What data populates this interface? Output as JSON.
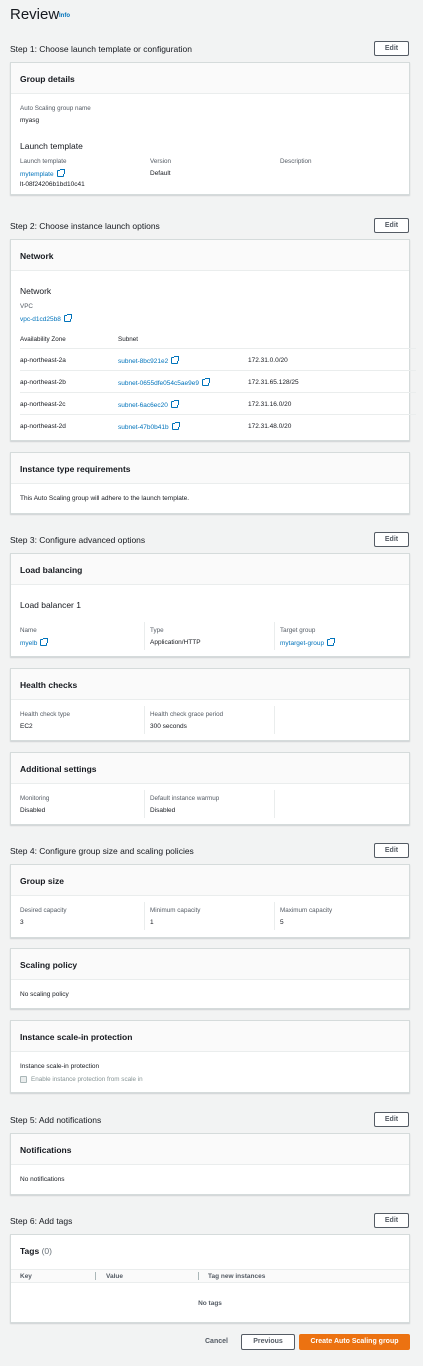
{
  "page": {
    "title": "Review",
    "info": "Info"
  },
  "edit_label": "Edit",
  "step1": {
    "label": "Step 1: Choose launch template or configuration",
    "group_details": {
      "title": "Group details",
      "asg_name_label": "Auto Scaling group name",
      "asg_name": "myasg",
      "lt_section": "Launch template",
      "lt_label": "Launch template",
      "lt_name": "mytemplate",
      "lt_id": "lt-08f24206b1bd10c41",
      "version_label": "Version",
      "version": "Default",
      "description_label": "Description"
    }
  },
  "step2": {
    "label": "Step 2: Choose instance launch options",
    "network": {
      "title": "Network",
      "subtitle": "Network",
      "vpc_label": "VPC",
      "vpc": "vpc-d1cd25b8",
      "az_header": "Availability Zone",
      "subnet_header": "Subnet",
      "rows": [
        {
          "az": "ap-northeast-2a",
          "subnet": "subnet-8bc921e2",
          "cidr": "172.31.0.0/20"
        },
        {
          "az": "ap-northeast-2b",
          "subnet": "subnet-0655dfe054c5ae9e9",
          "cidr": "172.31.65.128/25"
        },
        {
          "az": "ap-northeast-2c",
          "subnet": "subnet-6ac6ec20",
          "cidr": "172.31.16.0/20"
        },
        {
          "az": "ap-northeast-2d",
          "subnet": "subnet-47b0b41b",
          "cidr": "172.31.48.0/20"
        }
      ]
    },
    "instance_type": {
      "title": "Instance type requirements",
      "text": "This Auto Scaling group will adhere to the launch template."
    }
  },
  "step3": {
    "label": "Step 3: Configure advanced options",
    "load_balancing": {
      "title": "Load balancing",
      "subtitle": "Load balancer 1",
      "name_label": "Name",
      "name": "myelb",
      "type_label": "Type",
      "type": "Application/HTTP",
      "tg_label": "Target group",
      "tg": "mytarget-group"
    },
    "health_checks": {
      "title": "Health checks",
      "type_label": "Health check type",
      "type": "EC2",
      "grace_label": "Health check grace period",
      "grace": "300 seconds"
    },
    "additional": {
      "title": "Additional settings",
      "monitoring_label": "Monitoring",
      "monitoring": "Disabled",
      "warmup_label": "Default instance warmup",
      "warmup": "Disabled"
    }
  },
  "step4": {
    "label": "Step 4: Configure group size and scaling policies",
    "group_size": {
      "title": "Group size",
      "desired_label": "Desired capacity",
      "desired": "3",
      "min_label": "Minimum capacity",
      "min": "1",
      "max_label": "Maximum capacity",
      "max": "5"
    },
    "scaling_policy": {
      "title": "Scaling policy",
      "text": "No scaling policy"
    },
    "scale_in": {
      "title": "Instance scale-in protection",
      "label": "Instance scale-in protection",
      "checkbox_label": "Enable instance protection from scale in"
    }
  },
  "step5": {
    "label": "Step 5: Add notifications",
    "notifications": {
      "title": "Notifications",
      "text": "No notifications"
    }
  },
  "step6": {
    "label": "Step 6: Add tags",
    "tags": {
      "title": "Tags",
      "count": "(0)",
      "col_key": "Key",
      "col_value": "Value",
      "col_tag_new": "Tag new instances",
      "empty": "No tags"
    }
  },
  "footer": {
    "cancel": "Cancel",
    "previous": "Previous",
    "create": "Create Auto Scaling group"
  },
  "colors": {
    "link": "#0073bb",
    "primary": "#ec7211",
    "background": "#f2f3f3"
  }
}
